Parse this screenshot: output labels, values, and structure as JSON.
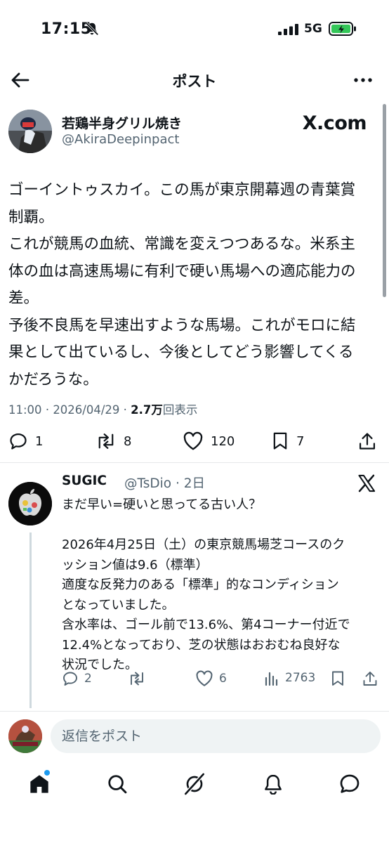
{
  "status_bar": {
    "time": "17:15",
    "network": "5G"
  },
  "header": {
    "title": "ポスト"
  },
  "post": {
    "author_name": "若鶏半身グリル焼き",
    "author_handle": "@AkiraDeepinpact",
    "source_badge": "X.com",
    "body": "ゴーイントゥスカイ。この馬が東京開幕週の青葉賞\n制覇。\nこれが競馬の血統、常識を変えつつあるな。米系主\n体の血は高速馬場に有利で硬い馬場への適応能力の\n差。\n予後不良馬を早速出すような馬場。これがモロに結\n果として出ているし、今後としてどう影響してくる\nかだろうな。",
    "time": "11:00",
    "date": "2026/04/29",
    "views": "2.7万",
    "views_label": "回表示",
    "meta_separator": "·",
    "replies": "1",
    "reposts": "8",
    "likes": "120",
    "bookmarks": "7"
  },
  "reply": {
    "author_name": "SUGIC",
    "author_handle": "@TsDio",
    "age": "2日",
    "meta_separator": "·",
    "body": "まだ早い=硬いと思ってる古い人？\n\n2026年4月25日（土）の東京競馬場芝コースのク\nッション値は9.6（標準）\n適度な反発力のある「標準」的なコンディション\nとなっていました。\n含水率は、ゴール前で13.6%、第4コーナー付近で\n12.4%となっており、芝の状態はおおむね良好な\n状況でした。",
    "replies": "2",
    "reposts": "",
    "likes": "6",
    "views": "2763"
  },
  "compose": {
    "placeholder": "返信をポスト"
  },
  "icons": {
    "back": "arrow-left-icon",
    "more": "more-horizontal-icon",
    "reply": "comment-icon",
    "repost": "repost-icon",
    "like": "heart-icon",
    "bookmark": "bookmark-icon",
    "share": "share-icon",
    "views": "bar-chart-icon",
    "home": "home-icon",
    "search": "search-icon",
    "grok": "grok-icon",
    "notifications": "bell-icon",
    "messages": "message-icon"
  },
  "colors": {
    "text": "#0f1419",
    "muted": "#536471",
    "accent": "#1d9bf0",
    "battery": "#34c759"
  }
}
